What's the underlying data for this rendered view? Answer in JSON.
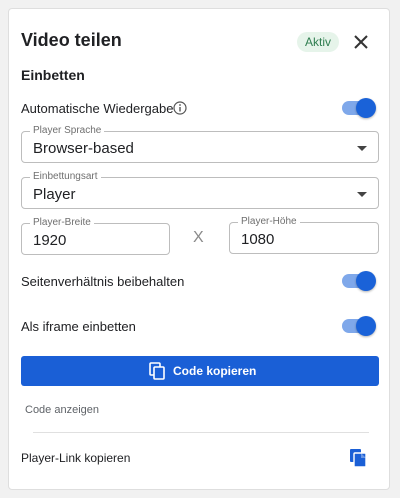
{
  "dialog": {
    "title": "Video teilen",
    "badge": "Aktiv",
    "close_icon": "close-icon"
  },
  "embed": {
    "section_title": "Einbetten",
    "autoplay": {
      "label": "Automatische Wiedergabe",
      "enabled": true
    },
    "player_language": {
      "label": "Player Sprache",
      "value": "Browser-based"
    },
    "embed_type": {
      "label": "Einbettungsart",
      "value": "Player"
    },
    "player_width": {
      "label": "Player-Breite",
      "value": "1920"
    },
    "separator": "X",
    "player_height": {
      "label": "Player-Höhe",
      "value": "1080"
    },
    "keep_aspect_ratio": {
      "label": "Seitenverhältnis beibehalten",
      "enabled": true
    },
    "iframe": {
      "label": "Als iframe einbetten",
      "enabled": true
    },
    "copy_code_button": "Code kopieren",
    "show_code": "Code anzeigen",
    "copy_player_link": "Player-Link kopieren"
  },
  "colors": {
    "accent": "#1a5fd6",
    "toggle_track": "#7fa8ea",
    "badge_bg": "#e6f4ea",
    "badge_text": "#2e7d4f"
  }
}
